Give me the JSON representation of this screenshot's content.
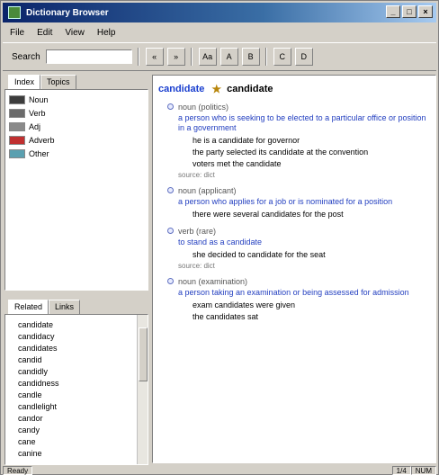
{
  "window": {
    "title": "Dictionary Browser"
  },
  "menu": [
    "File",
    "Edit",
    "View",
    "Help"
  ],
  "toolbar": {
    "search_label": "Search",
    "search_value": "",
    "buttons": [
      "«",
      "»",
      "Aa",
      "A",
      "B",
      "C",
      "D"
    ]
  },
  "left": {
    "tabs": [
      "Index",
      "Topics"
    ],
    "items": [
      {
        "label": "Noun",
        "color": "#3c3c3c"
      },
      {
        "label": "Verb",
        "color": "#6b6b6b"
      },
      {
        "label": "Adj",
        "color": "#8a8a8a"
      },
      {
        "label": "Adverb",
        "color": "#c03030"
      },
      {
        "label": "Other",
        "color": "#5aa0b0"
      }
    ],
    "lower_tabs": [
      "Related",
      "Links"
    ],
    "words": [
      "candidate",
      "candidacy",
      "candidates",
      "candid",
      "candidly",
      "candidness",
      "candle",
      "candlelight",
      "candor",
      "candy",
      "cane",
      "canine"
    ]
  },
  "content": {
    "word": "candidate",
    "star": "★",
    "entries": [
      {
        "pos": "noun (politics)",
        "gloss": "a person who is seeking to be elected to a particular office or position in a government",
        "examples": [
          "he is a candidate for governor",
          "the party selected its candidate at the convention",
          "voters met the candidate"
        ],
        "source": "source: dict"
      },
      {
        "pos": "noun (applicant)",
        "gloss": "a person who applies for a job or is nominated for a position",
        "examples": [
          "there were several candidates for the post"
        ],
        "source": ""
      },
      {
        "pos": "verb (rare)",
        "gloss": "to stand as a candidate",
        "examples": [
          "she decided to candidate for the seat"
        ],
        "source": "source: dict"
      },
      {
        "pos": "noun (examination)",
        "gloss": "a person taking an examination or being assessed for admission",
        "examples": [
          "exam candidates were given",
          "the candidates sat"
        ],
        "source": ""
      }
    ]
  },
  "status": {
    "left": "Ready",
    "mid": "1/4",
    "right": "NUM"
  }
}
